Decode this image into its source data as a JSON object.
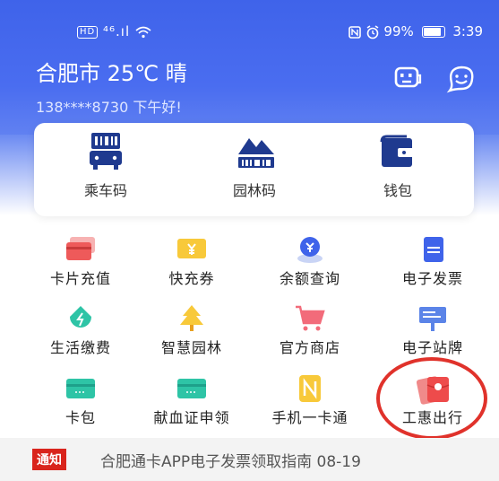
{
  "status_bar": {
    "hd": "HD",
    "signal": "⁴⁶.ıl",
    "battery": "99%",
    "time": "3:39"
  },
  "header": {
    "city_weather": "合肥市 25℃ 晴",
    "greeting": "138****8730 下午好!"
  },
  "quick_card": [
    {
      "label": "乘车码"
    },
    {
      "label": "园林码"
    },
    {
      "label": "钱包"
    }
  ],
  "services": [
    {
      "label": "卡片充值"
    },
    {
      "label": "快充券"
    },
    {
      "label": "余额查询"
    },
    {
      "label": "电子发票"
    },
    {
      "label": "生活缴费"
    },
    {
      "label": "智慧园林"
    },
    {
      "label": "官方商店"
    },
    {
      "label": "电子站牌"
    },
    {
      "label": "卡包"
    },
    {
      "label": "献血证申领"
    },
    {
      "label": "手机一卡通"
    },
    {
      "label": "工惠出行"
    }
  ],
  "notice": {
    "tag": "通知",
    "text": "合肥通卡APP电子发票领取指南 08-19"
  },
  "colors": {
    "brand_blue": "#4a6df0",
    "highlight_red": "#e0322b",
    "notice_red": "#d9241c"
  }
}
